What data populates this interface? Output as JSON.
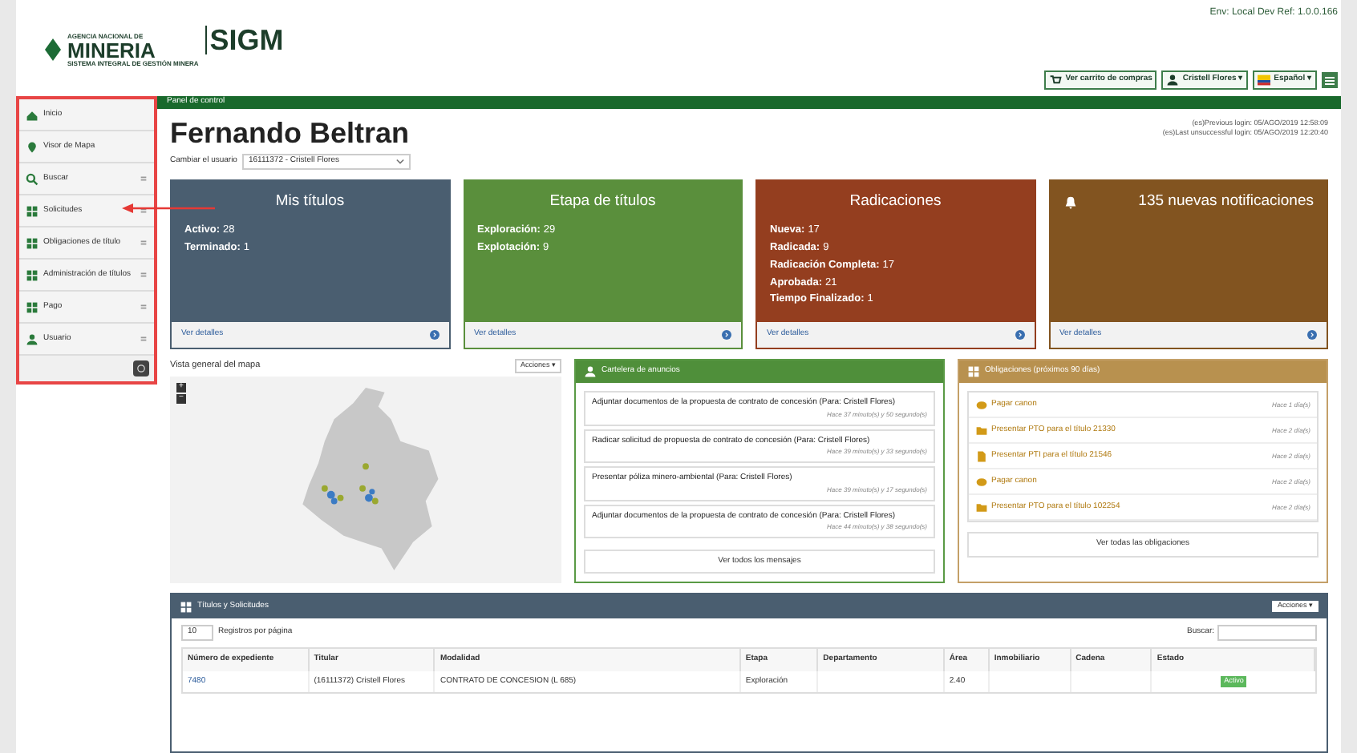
{
  "header": {
    "logo_agency": "AGENCIA NACIONAL DE",
    "logo_name": "MINERIA",
    "logo_app": "SIGM",
    "logo_subtitle": "SISTEMA INTEGRAL DE GESTIÓN MINERA",
    "env": "Env: Local Dev Ref: 1.0.0.166",
    "buttons": [
      {
        "label": "Ver carrito de compras"
      },
      {
        "label": "Cristell Flores ▾"
      },
      {
        "label": "Español ▾"
      }
    ]
  },
  "sidebar": {
    "items": [
      {
        "label": "Inicio",
        "has_sub": false
      },
      {
        "label": "Visor de Mapa",
        "has_sub": false
      },
      {
        "label": "Buscar",
        "has_sub": true
      },
      {
        "label": "Solicitudes",
        "has_sub": true
      },
      {
        "label": "Obligaciones de título",
        "has_sub": true
      },
      {
        "label": "Administración de títulos",
        "has_sub": true
      },
      {
        "label": "Pago",
        "has_sub": true
      },
      {
        "label": "Usuario",
        "has_sub": true
      }
    ]
  },
  "breadcrumb": "Panel de control",
  "user": {
    "name": "Fernando Beltran",
    "previous_login": "(es)Previous login: 05/AGO/2019 12:58:09",
    "last_unsuccessful_login": "(es)Last unsuccessful login: 05/AGO/2019 12:20:40",
    "switch_label": "Cambiar el usuario",
    "switch_value": "16111372 - Cristell Flores"
  },
  "cards": [
    {
      "title": "Mis títulos",
      "color": "#4a5e70",
      "bell": false,
      "lines": [
        {
          "label": "Activo:",
          "value": "28"
        },
        {
          "label": "Terminado:",
          "value": "1"
        }
      ],
      "footer": "Ver detalles"
    },
    {
      "title": "Etapa de títulos",
      "color": "#5a8f3c",
      "bell": false,
      "lines": [
        {
          "label": "Exploración:",
          "value": "29"
        },
        {
          "label": "Explotación:",
          "value": "9"
        }
      ],
      "footer": "Ver detalles"
    },
    {
      "title": "Radicaciones",
      "color": "#943e1f",
      "bell": false,
      "lines": [
        {
          "label": "Nueva:",
          "value": "17"
        },
        {
          "label": "Radicada:",
          "value": "9"
        },
        {
          "label": "Radicación Completa:",
          "value": "17"
        },
        {
          "label": "Aprobada:",
          "value": "21"
        },
        {
          "label": "Tiempo Finalizado:",
          "value": "1"
        }
      ],
      "footer": "Ver detalles"
    },
    {
      "title": "135 nuevas notificaciones",
      "color": "#825420",
      "bell": true,
      "footer": "Ver detalles"
    }
  ],
  "map_panel": {
    "title": "Vista general del mapa",
    "actions": "Acciones ▾",
    "zoom_in": "+",
    "zoom_out": "−"
  },
  "messages_panel": {
    "title": "Cartelera de anuncios",
    "items": [
      {
        "text": "Adjuntar documentos de la propuesta de contrato de concesión (Para: Cristell Flores)",
        "time": "Hace 37 minuto(s) y 50 segundo(s)"
      },
      {
        "text": "Radicar solicitud de propuesta de contrato de concesión (Para: Cristell Flores)",
        "time": "Hace 39 minuto(s) y 33 segundo(s)"
      },
      {
        "text": "Presentar póliza minero-ambiental (Para: Cristell Flores)",
        "time": "Hace 39 minuto(s) y 17 segundo(s)"
      },
      {
        "text": "Adjuntar documentos de la propuesta de contrato de concesión (Para: Cristell Flores)",
        "time": "Hace 44 minuto(s) y 38 segundo(s)"
      }
    ],
    "button": "Ver todos los mensajes"
  },
  "obligations_panel": {
    "title": "Obligaciones (próximos 90 días)",
    "items": [
      {
        "text": "Pagar canon",
        "time": "Hace 1 día(s)"
      },
      {
        "text": "Presentar PTO para el título 21330",
        "time": "Hace 2 día(s)"
      },
      {
        "text": "Presentar PTI para el título 21546",
        "time": "Hace 2 día(s)"
      },
      {
        "text": "Pagar canon",
        "time": "Hace 2 día(s)"
      },
      {
        "text": "Presentar PTO para el título 102254",
        "time": "Hace 2 día(s)"
      }
    ],
    "button": "Ver todas las obligaciones"
  },
  "table_panel": {
    "title": "Títulos y Solicitudes",
    "actions": "Acciones ▾",
    "page_size": "10",
    "page_size_label": "Registros por página",
    "search_label": "Buscar:",
    "columns": [
      "Número de expediente",
      "Titular",
      "Modalidad",
      "Etapa",
      "Departamento",
      "Área",
      "Inmobiliario",
      "Cadena",
      "Estado"
    ],
    "rows": [
      {
        "cells": [
          "7480",
          "(16111372) Cristell Flores",
          "CONTRATO DE CONCESION (L 685)",
          "Exploración",
          "",
          "2.40",
          "",
          "",
          ""
        ],
        "status": "Activo"
      }
    ]
  }
}
